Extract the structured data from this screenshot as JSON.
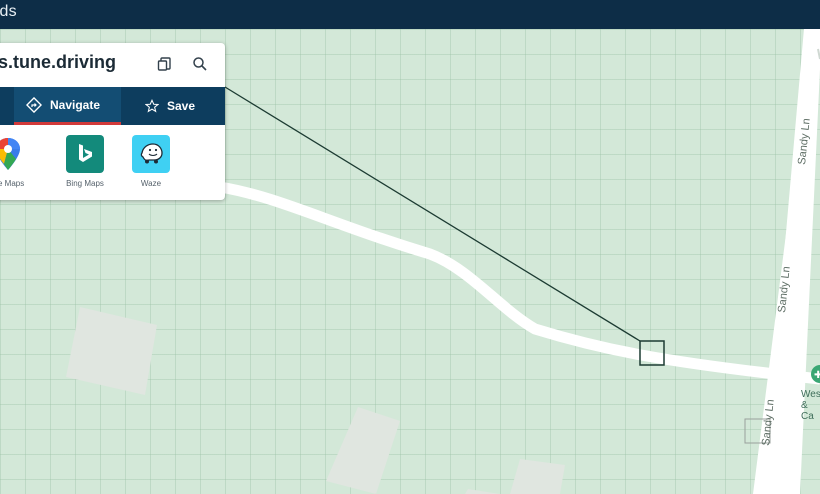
{
  "app": {
    "title": "rds"
  },
  "card": {
    "title": "s.tune.driving",
    "icons": {
      "copy": "copy-icon",
      "search": "search-icon"
    },
    "tabs": [
      {
        "label": "",
        "active": false
      },
      {
        "label": "Navigate",
        "active": true,
        "icon": "diamond-arrow-icon"
      },
      {
        "label": "Save",
        "active": false,
        "icon": "star-icon"
      }
    ],
    "apps": [
      {
        "label": "gle Maps",
        "icon": "google-maps-icon"
      },
      {
        "label": "Bing Maps",
        "icon": "bing-maps-icon",
        "color": "#138a7b"
      },
      {
        "label": "Waze",
        "icon": "waze-icon",
        "color": "#3fd0f3"
      }
    ]
  },
  "map": {
    "road_labels": [
      "Sandy Ln",
      "Sandy Ln",
      "Sandy Ln"
    ],
    "poi": {
      "label_line1": "Wes",
      "label_line2": "& Ca",
      "icon": "map-pin-icon"
    }
  },
  "colors": {
    "topbar": "#0d2d47",
    "tabbar": "#0d3d5e",
    "accent": "#d23a3a",
    "map_bg": "#d3e8d8"
  }
}
